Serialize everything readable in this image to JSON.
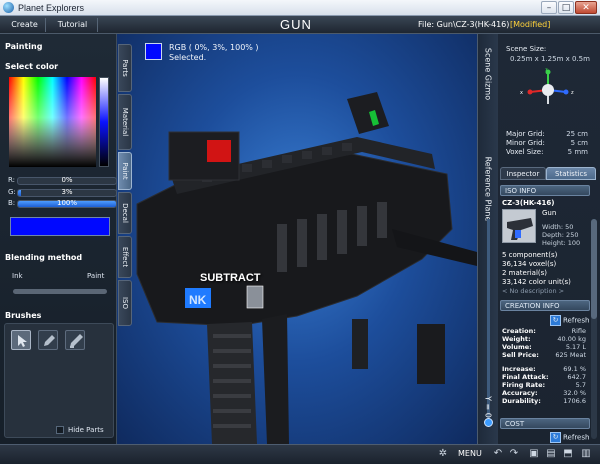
{
  "window": {
    "title": "Planet Explorers",
    "minimize": "–",
    "maximize": "□",
    "close": "✕"
  },
  "menubar": {
    "create": "Create",
    "tutorial": "Tutorial",
    "title": "GUN",
    "file": "File: Gun\\CZ-3(HK-416)",
    "status": "[Modified]"
  },
  "viewport": {
    "rgb_line1": "RGB ( 0%, 3%, 100% )",
    "rgb_line2": "Selected.",
    "mode_label": "SUBTRACT",
    "color": "#0008ff"
  },
  "paint_panel": {
    "title": "Painting",
    "select_color": "Select color",
    "r": {
      "label": "R:",
      "value": "0%",
      "level": 0
    },
    "g": {
      "label": "G:",
      "value": "3%",
      "level": 3
    },
    "b": {
      "label": "B:",
      "value": "100%",
      "level": 100
    },
    "blending_title": "Blending method",
    "ink": "Ink",
    "paint": "Paint",
    "brushes_title": "Brushes",
    "brushes": [
      {
        "name": "select-brush-icon"
      },
      {
        "name": "pencil-icon"
      },
      {
        "name": "pen-icon"
      }
    ],
    "hide_parts": "Hide Parts"
  },
  "side_tabs": [
    "Parts",
    "Material",
    "Paint",
    "Decal",
    "Effect",
    "ISO"
  ],
  "right_tabs": {
    "scene_gizmo": "Scene Gizmo",
    "reference_plane": "Reference Plane",
    "y_value": "Y = 0"
  },
  "scene": {
    "size_label": "Scene Size:",
    "size_value": "0.25m x 1.25m x 0.5m",
    "major_grid_label": "Major Grid:",
    "major_grid": "25 cm",
    "minor_grid_label": "Minor Grid:",
    "minor_grid": "5 cm",
    "voxel_size_label": "Voxel Size:",
    "voxel_size": "5 mm"
  },
  "inspector": {
    "tab_inspector": "Inspector",
    "tab_statistics": "Statistics"
  },
  "iso_info": {
    "header": "ISO INFO",
    "name": "CZ-3(HK-416)",
    "type": "Gun",
    "width": "Width: 50",
    "depth": "Depth: 250",
    "height": "Height: 100",
    "components": "5 component(s)",
    "voxels": "36,134 voxel(s)",
    "materials": "2 material(s)",
    "color_units": "33,142 color unit(s)",
    "description": "< No description >"
  },
  "creation_info": {
    "header": "CREATION INFO",
    "refresh": "Refresh",
    "rows": [
      {
        "k": "Creation:",
        "v": "Rifle"
      },
      {
        "k": "Weight:",
        "v": "40.00 kg"
      },
      {
        "k": "Volume:",
        "v": "5.17 L"
      },
      {
        "k": "Sell Price:",
        "v": "625 Meat"
      },
      {
        "k": "Increase:",
        "v": "69.1 %"
      },
      {
        "k": "Final Attack:",
        "v": "642.7"
      },
      {
        "k": "Firing Rate:",
        "v": "5.7"
      },
      {
        "k": "Accuracy:",
        "v": "32.0 %"
      },
      {
        "k": "Durability:",
        "v": "1706.6"
      }
    ]
  },
  "cost": {
    "header": "COST",
    "refresh": "Refresh"
  },
  "bottombar": {
    "menu": "MENU"
  }
}
